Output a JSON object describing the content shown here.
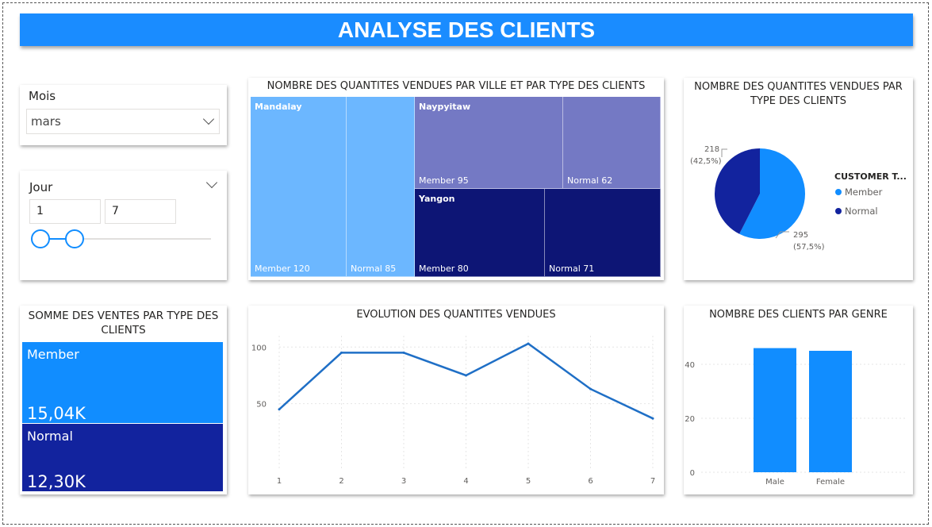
{
  "title": "ANALYSE DES CLIENTS",
  "colors": {
    "banner": "#1a8cff",
    "member": "#118dff",
    "normal": "#12239e",
    "mandalay": "#6cb7ff",
    "naypyitaw": "#7479c4",
    "yangon": "#0d1575"
  },
  "slicer_month": {
    "label": "Mois",
    "value": "mars",
    "icon": "chevron-down-icon"
  },
  "slicer_day": {
    "label": "Jour",
    "min": "1",
    "max": "7",
    "range": [
      1,
      7
    ],
    "icon": "chevron-down-icon"
  },
  "treemap": {
    "title": "NOMBRE DES QUANTITES VENDUES PAR VILLE ET PAR TYPE DES CLIENTS",
    "tiles": {
      "mandalay": {
        "city": "Mandalay",
        "member": "Member 120",
        "normal": "Normal 85"
      },
      "naypyitaw": {
        "city": "Naypyitaw",
        "member": "Member 95",
        "normal": "Normal 62"
      },
      "yangon": {
        "city": "Yangon",
        "member": "Member 80",
        "normal": "Normal 71"
      }
    }
  },
  "kpi": {
    "title": "SOMME DES VENTES PAR TYPE DES CLIENTS",
    "member": {
      "label": "Member",
      "value": "15,04K"
    },
    "normal": {
      "label": "Normal",
      "value": "12,30K"
    }
  },
  "chart_data": [
    {
      "type": "pie",
      "title": "NOMBRE DES QUANTITES VENDUES PAR TYPE DES CLIENTS",
      "legend_title": "CUSTOMER T...",
      "legend_placement": "right",
      "labels": [
        "Member",
        "Normal"
      ],
      "values": [
        295,
        218
      ],
      "percent_labels": [
        "(57,5%)",
        "(42,5%)"
      ],
      "value_labels": [
        "295",
        "218"
      ]
    },
    {
      "type": "line",
      "title": "EVOLUTION DES QUANTITES VENDUES",
      "x": [
        1,
        2,
        3,
        4,
        5,
        6,
        7
      ],
      "y": [
        45,
        95,
        95,
        75,
        103,
        63,
        37
      ],
      "yticks": [
        50,
        100
      ],
      "ylim": [
        0,
        110
      ],
      "grid": true
    },
    {
      "type": "bar",
      "title": "NOMBRE DES CLIENTS PAR GENRE",
      "categories": [
        "Male",
        "Female"
      ],
      "values": [
        46,
        45
      ],
      "yticks": [
        0,
        20,
        40
      ],
      "ylim": [
        0,
        50
      ],
      "grid": true
    }
  ]
}
